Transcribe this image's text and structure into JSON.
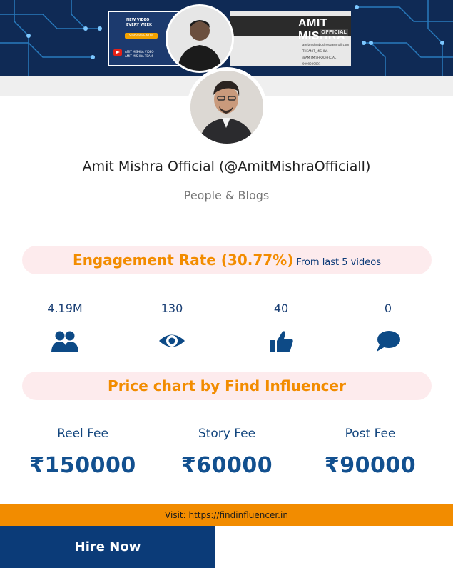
{
  "banner": {
    "promo_line1": "NEW VIDEO",
    "promo_line2": "EVERY WEEK",
    "subscribe_label": "SUBSCRIBE NOW",
    "youtube_line1": "AMIT MISHRA VIDEO",
    "youtube_line2": "AMIT MISHRA TEAM",
    "name": "AMIT MISHRA",
    "tag": "OFFICIAL",
    "email": "amitmishrabusiness@gmail.com",
    "instagram": "THEAMIT_MISHRA",
    "handle": "@AMITMISHRAOFFICIAL",
    "phone": "9999999991"
  },
  "profile": {
    "name": "Amit Mishra Official (@AmitMishraOfficiall)",
    "category": "People & Blogs"
  },
  "engagement": {
    "title": "Engagement Rate (30.77%)",
    "subtitle": "From last 5 videos"
  },
  "stats": [
    {
      "value": "4.19M",
      "icon": "users-icon"
    },
    {
      "value": "130",
      "icon": "eye-icon"
    },
    {
      "value": "40",
      "icon": "thumbs-up-icon"
    },
    {
      "value": "0",
      "icon": "comment-icon"
    }
  ],
  "price_chart": {
    "title": "Price chart by Find Influencer",
    "fees": [
      {
        "label": "Reel Fee",
        "value": "₹150000"
      },
      {
        "label": "Story Fee",
        "value": "₹60000"
      },
      {
        "label": "Post Fee",
        "value": "₹90000"
      }
    ]
  },
  "footer": {
    "visit_text": "Visit: https://findinfluencer.in",
    "hire_label": "Hire Now"
  },
  "colors": {
    "accent_orange": "#f28c00",
    "navy": "#0b3b78",
    "pill_bg": "#fdebed"
  }
}
